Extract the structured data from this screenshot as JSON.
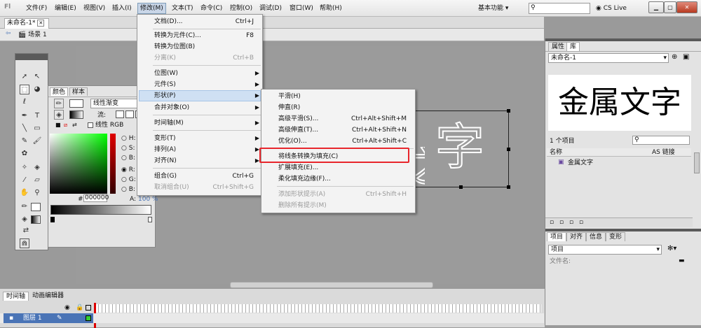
{
  "app": {
    "logo": "Fl"
  },
  "menubar": {
    "items": [
      "文件(F)",
      "编辑(E)",
      "视图(V)",
      "插入(I)",
      "修改(M)",
      "文本(T)",
      "命令(C)",
      "控制(O)",
      "调试(D)",
      "窗口(W)",
      "帮助(H)"
    ],
    "workspace": "基本功能",
    "cs_live": "CS Live"
  },
  "document": {
    "tab": "未命名-1*",
    "scene": "场景 1"
  },
  "modify_menu": {
    "items": [
      {
        "label": "文档(D)...",
        "shortcut": "Ctrl+J"
      },
      {
        "label": "转换为元件(C)...",
        "shortcut": "F8"
      },
      {
        "label": "转换为位图(B)",
        "shortcut": ""
      },
      {
        "label": "分离(K)",
        "shortcut": "Ctrl+B"
      },
      {
        "label": "位图(W)",
        "shortcut": ""
      },
      {
        "label": "元件(S)",
        "shortcut": ""
      },
      {
        "label": "形状(P)",
        "shortcut": ""
      },
      {
        "label": "合并对象(O)",
        "shortcut": ""
      },
      {
        "label": "时间轴(M)",
        "shortcut": ""
      },
      {
        "label": "变形(T)",
        "shortcut": ""
      },
      {
        "label": "排列(A)",
        "shortcut": ""
      },
      {
        "label": "对齐(N)",
        "shortcut": ""
      },
      {
        "label": "组合(G)",
        "shortcut": "Ctrl+G"
      },
      {
        "label": "取消组合(U)",
        "shortcut": "Ctrl+Shift+G"
      }
    ]
  },
  "shape_menu": {
    "items": [
      {
        "label": "平滑(H)",
        "shortcut": ""
      },
      {
        "label": "伸直(R)",
        "shortcut": ""
      },
      {
        "label": "高级平滑(S)...",
        "shortcut": "Ctrl+Alt+Shift+M"
      },
      {
        "label": "高级伸直(T)...",
        "shortcut": "Ctrl+Alt+Shift+N"
      },
      {
        "label": "优化(O)...",
        "shortcut": "Ctrl+Alt+Shift+C"
      },
      {
        "label": "将线条转换为填充(C)",
        "shortcut": ""
      },
      {
        "label": "扩展填充(E)...",
        "shortcut": ""
      },
      {
        "label": "柔化填充边缘(F)...",
        "shortcut": ""
      },
      {
        "label": "添加形状提示(A)",
        "shortcut": "Ctrl+Shift+H"
      },
      {
        "label": "删除所有提示(M)",
        "shortcut": ""
      }
    ]
  },
  "color_panel": {
    "tabs": [
      "颜色",
      "样本"
    ],
    "type": "线性渐变",
    "flow_label": "流:",
    "linear_rgb": "线性 RGB",
    "hsb": [
      "H:",
      "S:",
      "B:"
    ],
    "rgb": [
      "R:",
      "G:",
      "B:"
    ],
    "alpha_label": "A:",
    "alpha_value": "100 %",
    "hex_label": "#",
    "hex_value": "000000"
  },
  "stage": {
    "text": "字",
    "left_partial": "之"
  },
  "right_panel": {
    "tabs": [
      "属性",
      "库"
    ],
    "doc_select": "未命名-1",
    "preview_text": "金属文字",
    "count": "1 个项目",
    "col_name": "名称",
    "col_link": "AS 链接",
    "library_item": "金属文字",
    "tabs2": [
      "项目",
      "对齐",
      "信息",
      "变形"
    ],
    "item_select": "项目",
    "filename_label": "文件名:"
  },
  "timeline": {
    "tabs": [
      "时间轴",
      "动画编辑器"
    ],
    "layer": "图层 1"
  }
}
